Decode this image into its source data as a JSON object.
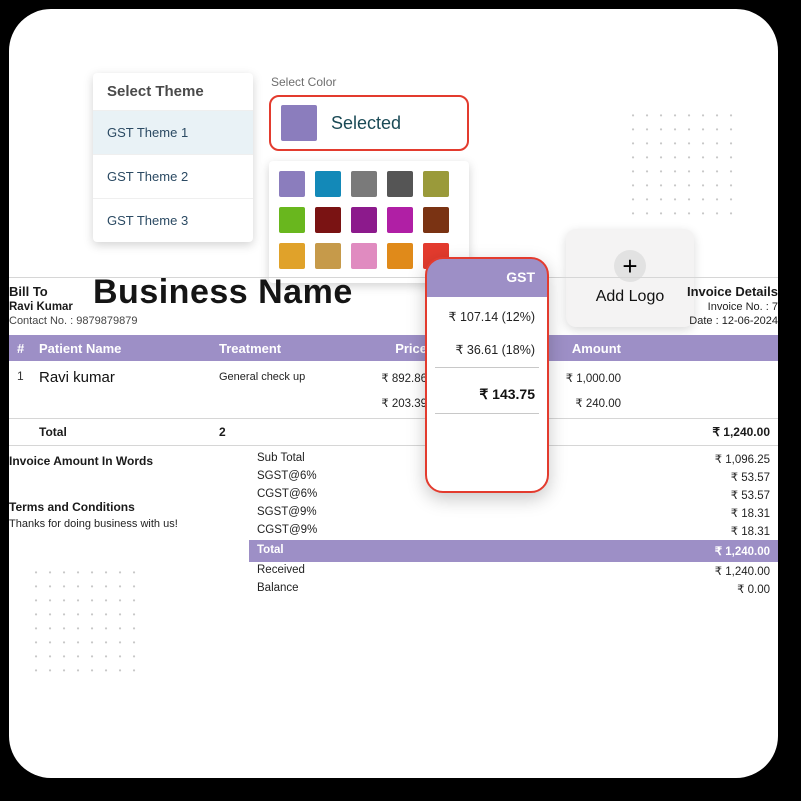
{
  "theme_panel": {
    "header": "Select Theme",
    "items": [
      {
        "label": "GST Theme 1",
        "active": true
      },
      {
        "label": "GST Theme 2",
        "active": false
      },
      {
        "label": "GST Theme 3",
        "active": false
      }
    ]
  },
  "color_selector": {
    "label": "Select Color",
    "selected_text": "Selected",
    "selected_hex": "#8b7dbd",
    "palette": [
      [
        "#8b7dbd",
        "#1389b8",
        "#7a7a7a",
        "#555555",
        "#9a9a3a"
      ],
      [
        "#69b71e",
        "#7a1313",
        "#8c1a8c",
        "#b01fa5",
        "#7a3313"
      ],
      [
        "#e0a22a",
        "#c69a4a",
        "#e08bc0",
        "#e08a1a",
        "#e33b2e"
      ]
    ]
  },
  "add_logo_label": "Add Logo",
  "business_name": "Business Name",
  "invoice": {
    "bill_to_title": "Bill To",
    "customer_name": "Ravi Kumar",
    "contact_label": "Contact No. :",
    "contact_value": "9879879879",
    "details_title": "Invoice Details",
    "invoice_no_label": "Invoice No. :",
    "invoice_no_value": "7",
    "date_label": "Date :",
    "date_value": "12-06-2024",
    "columns": {
      "idx": "#",
      "patient": "Patient Name",
      "treatment": "Treatment",
      "price": "Price",
      "gst": "GST",
      "amount": "Amount"
    },
    "rows": [
      {
        "idx": "1",
        "patient": "Ravi kumar",
        "treatment": "General check up",
        "price": "₹ 892.86",
        "amount": "₹ 1,000.00"
      },
      {
        "idx": "",
        "patient": "",
        "treatment": "",
        "price": "₹ 203.39",
        "amount": "₹ 240.00"
      }
    ],
    "total_label": "Total",
    "total_qty": "2",
    "total_amount": "₹ 1,240.00",
    "words_label": "Invoice Amount In Words",
    "terms_title": "Terms and Conditions",
    "terms_body": "Thanks for doing business with us!",
    "summary": [
      {
        "k": "Sub Total",
        "v": "₹ 1,096.25"
      },
      {
        "k": "SGST@6%",
        "v": "₹ 53.57"
      },
      {
        "k": "CGST@6%",
        "v": "₹ 53.57"
      },
      {
        "k": "SGST@9%",
        "v": "₹ 18.31"
      },
      {
        "k": "CGST@9%",
        "v": "₹ 18.31"
      }
    ],
    "summary_total": {
      "k": "Total",
      "v": "₹ 1,240.00"
    },
    "received": {
      "k": "Received",
      "v": "₹ 1,240.00"
    },
    "balance": {
      "k": "Balance",
      "v": "₹ 0.00"
    }
  },
  "gst_overlay": {
    "header": "GST",
    "line1": "₹ 107.14 (12%)",
    "line2": "₹ 36.61 (18%)",
    "total": "₹ 143.75"
  }
}
